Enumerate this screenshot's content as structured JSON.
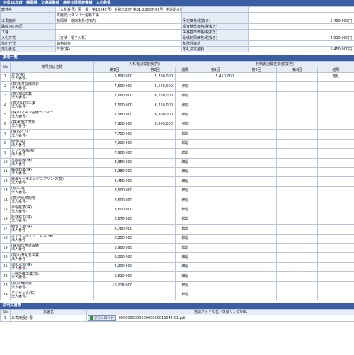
{
  "header_title": "平成31年度　静岡県　交通基盤部　施設支援局設備課　入札結果",
  "info": {
    "rows": [
      {
        "l1": "案件名",
        "v1": "（入札番号）園　番　第15042号）令和元年度[第31-Z2007-01号] 中遠総合庁舎",
        "l2": "",
        "v2": ""
      },
      {
        "l1": "",
        "v1": "本館防火ダンパー更新工事",
        "l2": "",
        "v2": ""
      },
      {
        "l1": "工事箇所",
        "v1": "静岡県　磐田市見付地内",
        "l2": "予定価格(税抜き)",
        "v2": "5,490,000円"
      },
      {
        "l1": "路線河川地区",
        "v1": "",
        "l2": "調査基準価格(税抜き)",
        "v2": ""
      },
      {
        "l1": "工種",
        "v1": "",
        "l2": "失格基準価格(税抜き)",
        "v2": ""
      },
      {
        "l1": "入札方式",
        "v1": "（方法・電子入札）",
        "l2": "最低制限価格(税抜き)",
        "v2": "4,910,000円"
      },
      {
        "l1": "落札方式",
        "v1": "価格競争",
        "l2": "基準評価値",
        "v2": ""
      },
      {
        "l1": "落札者名",
        "v1": "日管(株)",
        "l2": "落札決定金額",
        "v2": "5,450,000円"
      }
    ]
  },
  "list": {
    "section_title": "業者一覧",
    "col_no": "No",
    "col_name": "商号又は名称",
    "group_bid": "入札書記載金額(円)",
    "group_neg": "見積書記載金額(税抜き)",
    "sub1": "第1回",
    "sub2": "第2回",
    "sub_result": "結果",
    "sub3": "第3回",
    "neg_result": "結果",
    "rows": [
      {
        "no": "1",
        "name": "日管(株)",
        "rep": "法人番号-",
        "b1": "6,890,000",
        "b2": "5,700,000",
        "res": "",
        "n1": "5,450,000",
        "n2": "",
        "n3": "",
        "nres": "落札"
      },
      {
        "no": "2",
        "name": "(株)永井設備商会",
        "rep": "法人番号-",
        "b1": "7,600,000",
        "b2": "6,500,000",
        "res": "参加",
        "n1": "",
        "n2": "",
        "n3": "",
        "nres": ""
      },
      {
        "no": "3",
        "name": "(株)浅岡工業",
        "rep": "法人番号-",
        "b1": "7,660,000",
        "b2": "6,700,000",
        "res": "参加",
        "n1": "",
        "n2": "",
        "n3": "",
        "nres": ""
      },
      {
        "no": "4",
        "name": "(株)ひばり工業",
        "rep": "法人番号-",
        "b1": "7,500,000",
        "b2": "6,750,000",
        "res": "参加",
        "n1": "",
        "n2": "",
        "n3": "",
        "nres": ""
      },
      {
        "no": "5",
        "name": "(株)ハマネン設備センター",
        "rep": "法人番号-",
        "b1": "7,580,000",
        "b2": "6,800,000",
        "res": "参加",
        "n1": "",
        "n2": "",
        "n3": "",
        "nres": ""
      },
      {
        "no": "6",
        "name": "(株)和部工業所",
        "rep": "法人番号-",
        "b1": "7,900,000",
        "b2": "6,800,000",
        "res": "参加",
        "n1": "",
        "n2": "",
        "n3": "",
        "nres": ""
      },
      {
        "no": "7",
        "name": "(株)ダイバ",
        "rep": "法人番号-",
        "b1": "7,700,000",
        "b2": "",
        "res": "辞退",
        "n1": "",
        "n2": "",
        "n3": "",
        "nres": ""
      },
      {
        "no": "8",
        "name": "榮管(株)",
        "rep": "法人番号-",
        "b1": "7,800,000",
        "b2": "",
        "res": "辞退",
        "n1": "",
        "n2": "",
        "n3": "",
        "nres": ""
      },
      {
        "no": "9",
        "name": "シンワ設備(株)",
        "rep": "法人番号-",
        "b1": "7,900,000",
        "b2": "",
        "res": "辞退",
        "n1": "",
        "n2": "",
        "n3": "",
        "nres": ""
      },
      {
        "no": "10",
        "name": "光國建設(株)",
        "rep": "法人番号-",
        "b1": "8,350,000",
        "b2": "",
        "res": "辞退",
        "n1": "",
        "n2": "",
        "n3": "",
        "nres": ""
      },
      {
        "no": "11",
        "name": "静西商業(株)",
        "rep": "法人番号-",
        "b1": "8,380,000",
        "b2": "",
        "res": "辞退",
        "n1": "",
        "n2": "",
        "n3": "",
        "nres": ""
      },
      {
        "no": "12",
        "name": "東海サーモエンジニアリング(株)",
        "rep": "法人番号-",
        "b1": "8,450,000",
        "b2": "",
        "res": "辞退",
        "n1": "",
        "n2": "",
        "n3": "",
        "nres": ""
      },
      {
        "no": "13",
        "name": "(株)三鬼",
        "rep": "法人番号-",
        "b1": "8,600,000",
        "b2": "",
        "res": "辞退",
        "n1": "",
        "n2": "",
        "n3": "",
        "nres": ""
      },
      {
        "no": "14",
        "name": "(株)河原崎配管",
        "rep": "法人番号-",
        "b1": "8,600,000",
        "b2": "",
        "res": "辞退",
        "n1": "",
        "n2": "",
        "n3": "",
        "nres": ""
      },
      {
        "no": "15",
        "name": "赤堀産業(株)",
        "rep": "法人番号-",
        "b1": "8,600,000",
        "b2": "",
        "res": "辞退",
        "n1": "",
        "n2": "",
        "n3": "",
        "nres": ""
      },
      {
        "no": "16",
        "name": "松林鉄工(株)",
        "rep": "法人番号-",
        "b1": "8,670,000",
        "b2": "",
        "res": "辞退",
        "n1": "",
        "n2": "",
        "n3": "",
        "nres": ""
      },
      {
        "no": "17",
        "name": "明管工業(株)",
        "rep": "法人番号-",
        "b1": "8,780,000",
        "b2": "",
        "res": "辞退",
        "n1": "",
        "n2": "",
        "n3": "",
        "nres": ""
      },
      {
        "no": "18",
        "name": "スヤマビルテサービス(株)",
        "rep": "法人番号-",
        "b1": "8,800,000",
        "b2": "",
        "res": "辞退",
        "n1": "",
        "n2": "",
        "n3": "",
        "nres": ""
      },
      {
        "no": "19",
        "name": "(株)協伝水道設備",
        "rep": "法人番号-",
        "b1": "8,900,000",
        "b2": "",
        "res": "辞退",
        "n1": "",
        "n2": "",
        "n3": "",
        "nres": ""
      },
      {
        "no": "20",
        "name": "(有)九井配管工業",
        "rep": "法人番号-",
        "b1": "9,000,000",
        "b2": "",
        "res": "辞退",
        "n1": "",
        "n2": "",
        "n3": "",
        "nres": ""
      },
      {
        "no": "21",
        "name": "協和水道(株)",
        "rep": "法人番号-",
        "b1": "9,200,000",
        "b2": "",
        "res": "辞退",
        "n1": "",
        "n2": "",
        "n3": "",
        "nres": ""
      },
      {
        "no": "22",
        "name": "小野設備工業(株)",
        "rep": "法人番号-",
        "b1": "9,610,000",
        "b2": "",
        "res": "辞退",
        "n1": "",
        "n2": "",
        "n3": "",
        "nres": ""
      },
      {
        "no": "23",
        "name": "(株)小輪商会",
        "rep": "法人番号-",
        "b1": "10,218,000",
        "b2": "",
        "res": "辞退",
        "n1": "",
        "n2": "",
        "n3": "",
        "nres": ""
      },
      {
        "no": "24",
        "name": "フジヤック(株)",
        "rep": "法人番号-",
        "b1": "",
        "b2": "",
        "res": "辞退",
        "n1": "",
        "n2": "",
        "n3": "",
        "nres": ""
      }
    ]
  },
  "docs": {
    "section_title": "説明文書等",
    "col_no": "No",
    "col_name": "文書名",
    "col_file": "格納ファイル名／外部リンクURL",
    "rows": [
      {
        "no": "1",
        "name": "公表用設計書",
        "button": "ダウンロード",
        "file": "000000000000000000015042-01.pdf"
      }
    ]
  }
}
